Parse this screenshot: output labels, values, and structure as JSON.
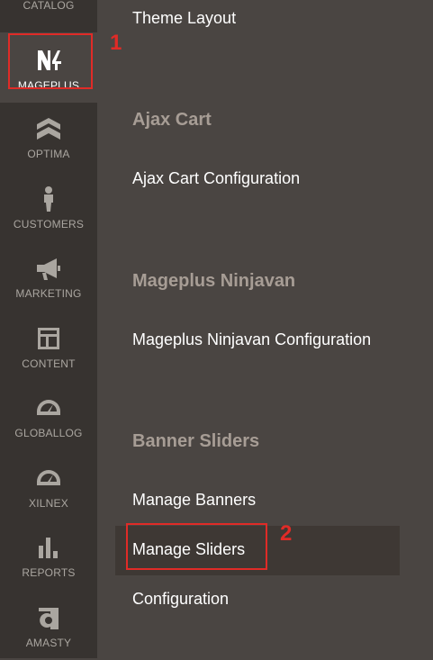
{
  "sidebar": {
    "items": [
      {
        "label": "CATALOG",
        "icon": "catalog-icon"
      },
      {
        "label": "MAGEPLUS",
        "icon": "mageplus-logo-icon"
      },
      {
        "label": "OPTIMA",
        "icon": "optima-icon"
      },
      {
        "label": "CUSTOMERS",
        "icon": "customers-icon"
      },
      {
        "label": "MARKETING",
        "icon": "megaphone-icon"
      },
      {
        "label": "CONTENT",
        "icon": "content-icon"
      },
      {
        "label": "GLOBALLOG",
        "icon": "gauge-icon"
      },
      {
        "label": "XILNEX",
        "icon": "gauge-icon"
      },
      {
        "label": "REPORTS",
        "icon": "bar-chart-icon"
      },
      {
        "label": "AMASTY",
        "icon": "amasty-icon"
      }
    ]
  },
  "submenu": {
    "theme_layout": "Theme Layout",
    "ajax_cart_title": "Ajax Cart",
    "ajax_cart_config": "Ajax Cart Configuration",
    "ninjavan_title": "Mageplus Ninjavan",
    "ninjavan_config": "Mageplus Ninjavan Configuration",
    "banner_sliders_title": "Banner Sliders",
    "manage_banners": "Manage Banners",
    "manage_sliders": "Manage Sliders",
    "configuration": "Configuration"
  },
  "annotations": {
    "step1": "1",
    "step2": "2",
    "color": "#e02b27"
  }
}
